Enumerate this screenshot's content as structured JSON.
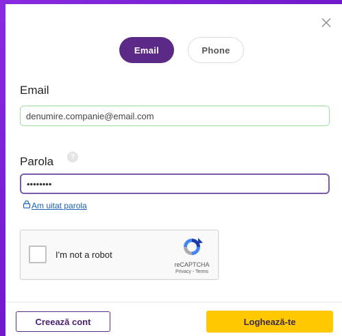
{
  "tabs": {
    "email_label": "Email",
    "phone_label": "Phone",
    "active": "Email"
  },
  "form": {
    "email_label": "Email",
    "email_value": "denumire.companie@email.com",
    "password_label": "Parola",
    "password_value": "••••••••",
    "forgot_label": "Am uitat parola"
  },
  "captcha": {
    "label": "I'm not a robot",
    "brand": "reCAPTCHA",
    "links": "Privacy - Terms"
  },
  "footer": {
    "create_label": "Creează cont",
    "login_label": "Loghează-te"
  },
  "colors": {
    "accent_purple": "#5b2a86",
    "login_yellow": "#ffc800",
    "email_border_green": "#9adf9a",
    "link_blue": "#1a5fb4"
  },
  "icons": {
    "close": "close-icon",
    "help": "help-icon",
    "lock": "lock-icon",
    "recaptcha": "recaptcha-logo-icon"
  }
}
